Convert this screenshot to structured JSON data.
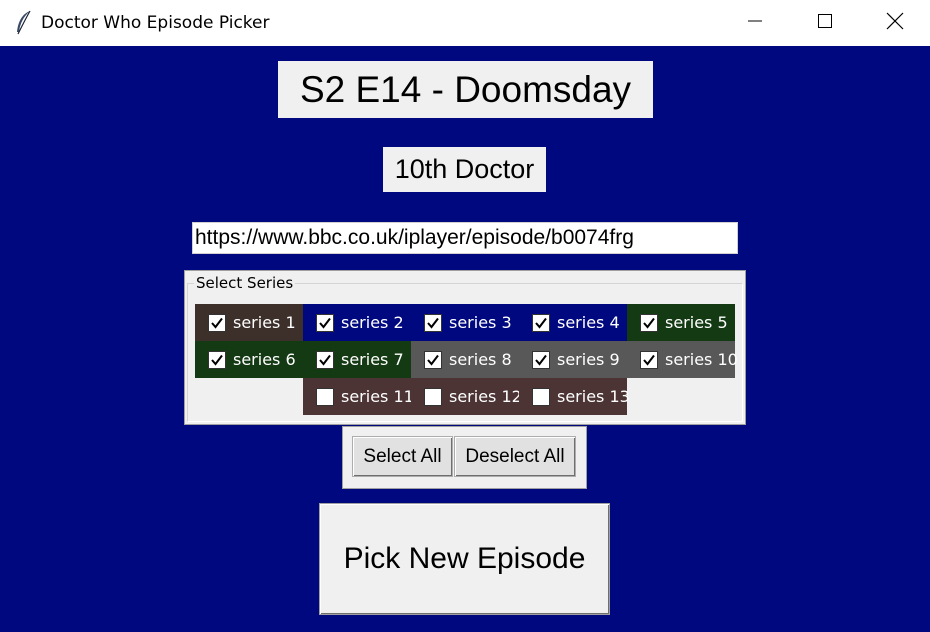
{
  "window": {
    "title": "Doctor Who Episode Picker",
    "app_icon": "feather-icon",
    "controls": {
      "minimize": "minimize-icon",
      "maximize": "maximize-icon",
      "close": "close-icon"
    }
  },
  "episode": {
    "title": "S2 E14 - Doomsday",
    "doctor": "10th Doctor",
    "url": "https://www.bbc.co.uk/iplayer/episode/b0074frg"
  },
  "series_group": {
    "legend": "Select Series",
    "items": [
      {
        "label": "series 1",
        "checked": true,
        "bg": "#3d2f2a"
      },
      {
        "label": "series 2",
        "checked": true,
        "bg": "#000880"
      },
      {
        "label": "series 3",
        "checked": true,
        "bg": "#000880"
      },
      {
        "label": "series 4",
        "checked": true,
        "bg": "#000880"
      },
      {
        "label": "series 5",
        "checked": true,
        "bg": "#143a14"
      },
      {
        "label": "series 6",
        "checked": true,
        "bg": "#143a14"
      },
      {
        "label": "series 7",
        "checked": true,
        "bg": "#143a14"
      },
      {
        "label": "series 8",
        "checked": true,
        "bg": "#585858"
      },
      {
        "label": "series 9",
        "checked": true,
        "bg": "#585858"
      },
      {
        "label": "series 10",
        "checked": true,
        "bg": "#585858"
      },
      {
        "label": "series 11",
        "checked": false,
        "bg": "#4c3434"
      },
      {
        "label": "series 12",
        "checked": false,
        "bg": "#4c3434"
      },
      {
        "label": "series 13",
        "checked": false,
        "bg": "#4c3434"
      }
    ]
  },
  "buttons": {
    "select_all": "Select All",
    "deselect_all": "Deselect All",
    "pick_new": "Pick New Episode"
  },
  "colors": {
    "background": "#000880",
    "panel": "#f0f0f0"
  }
}
